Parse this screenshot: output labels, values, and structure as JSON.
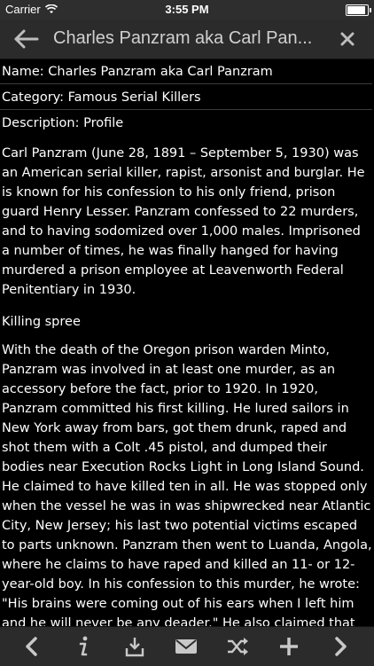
{
  "status": {
    "carrier": "Carrier",
    "time": "3:55 PM",
    "battery_level": 1.0
  },
  "navbar": {
    "title": "Charles Panzram aka Carl Pan...",
    "back_icon": "back-arrow-icon",
    "close_icon": "close-icon"
  },
  "fields": {
    "name": "Name: Charles Panzram aka Carl Panzram",
    "category": "Category: Famous Serial Killers",
    "description": "Description: Profile"
  },
  "body": {
    "intro": "Carl Panzram (June 28, 1891 – September 5, 1930) was an American serial killer, rapist, arsonist and burglar. He is known for his confession to his only friend, prison guard Henry Lesser. Panzram confessed to 22 murders, and to having sodomized over 1,000 males. Imprisoned a number of times, he was finally hanged for having murdered a prison employee at Leavenworth Federal Penitentiary in 1930.",
    "section_heading": "Killing spree",
    "section_text": "With the death of the Oregon prison warden Minto, Panzram was involved in at least one murder, as an accessory before the fact, prior to 1920. In 1920, Panzram committed his first killing. He lured sailors in New York away from bars, got them drunk, raped and shot them with a Colt .45 pistol, and dumped their bodies near Execution Rocks Light in Long Island Sound. He claimed to have killed ten in all. He was stopped only when the vessel he was in was shipwrecked near Atlantic City, New Jersey; his last two potential victims escaped to parts unknown. Panzram then went to Luanda, Angola, where he claims to have raped and killed an 11- or 12-year-old boy. In his confession to this murder, he wrote: \"His brains were coming out of his ears when I left him and he will never be any deader.\" He also claimed that he hired a rowing boat, shot the rowers and threw their bodies to"
  },
  "toolbar": {
    "icons": [
      "prev-icon",
      "info-icon",
      "download-icon",
      "mail-icon",
      "shuffle-icon",
      "add-icon",
      "next-icon"
    ]
  }
}
